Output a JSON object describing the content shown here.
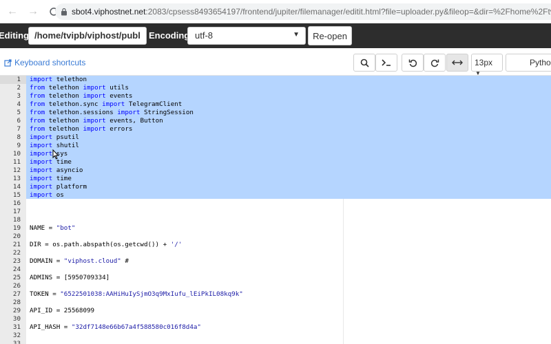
{
  "browser": {
    "url_host": "sbot4.viphostnet.net",
    "url_path": ":2083/cpsess8493654197/frontend/jupiter/filemanager/editit.html?file=uploader.py&fileop=&dir=%2Fhome%2Ftvipb%2F"
  },
  "editbar": {
    "editing_label": "Editing:",
    "path_value": "/home/tvipb/viphost/publ",
    "encoding_label": "Encoding:",
    "encoding_value": "utf-8",
    "reopen_label": "Re-open"
  },
  "toolbar": {
    "keyboard_shortcuts": "Keyboard shortcuts",
    "font_size": "13px",
    "mode": "Python"
  },
  "editor": {
    "lines": [
      {
        "n": "1",
        "t": "import telethon"
      },
      {
        "n": "2",
        "t": "from telethon import utils"
      },
      {
        "n": "3",
        "t": "from telethon import events"
      },
      {
        "n": "4",
        "t": "from telethon.sync import TelegramClient"
      },
      {
        "n": "5",
        "t": "from telethon.sessions import StringSession"
      },
      {
        "n": "6",
        "t": "from telethon import events, Button"
      },
      {
        "n": "7",
        "t": "from telethon import errors"
      },
      {
        "n": "8",
        "t": "import psutil"
      },
      {
        "n": "9",
        "t": "import shutil"
      },
      {
        "n": "10",
        "t": "import sys"
      },
      {
        "n": "11",
        "t": "import time"
      },
      {
        "n": "12",
        "t": "import asyncio"
      },
      {
        "n": "13",
        "t": "import time"
      },
      {
        "n": "14",
        "t": "import platform"
      },
      {
        "n": "15",
        "t": "import os"
      },
      {
        "n": "16",
        "t": ""
      },
      {
        "n": "17",
        "t": ""
      },
      {
        "n": "18",
        "t": ""
      },
      {
        "n": "19",
        "t": "NAME = \"bot\""
      },
      {
        "n": "20",
        "t": ""
      },
      {
        "n": "21",
        "t": "DIR = os.path.abspath(os.getcwd()) + '/'"
      },
      {
        "n": "22",
        "t": ""
      },
      {
        "n": "23",
        "t": "DOMAIN = \"viphost.cloud\" #"
      },
      {
        "n": "24",
        "t": ""
      },
      {
        "n": "25",
        "t": "ADMINS = [5950709334]"
      },
      {
        "n": "26",
        "t": ""
      },
      {
        "n": "27",
        "t": "TOKEN = \"6522501038:AAHiHuIySjmO3q9MxIufu_lEiPkIL08kq9k\""
      },
      {
        "n": "28",
        "t": ""
      },
      {
        "n": "29",
        "t": "API_ID = 25568099"
      },
      {
        "n": "30",
        "t": ""
      },
      {
        "n": "31",
        "t": "API_HASH = \"32df7148e66b67a4f588580c016f8d4a\""
      },
      {
        "n": "32",
        "t": ""
      },
      {
        "n": "33",
        "t": ""
      }
    ]
  }
}
